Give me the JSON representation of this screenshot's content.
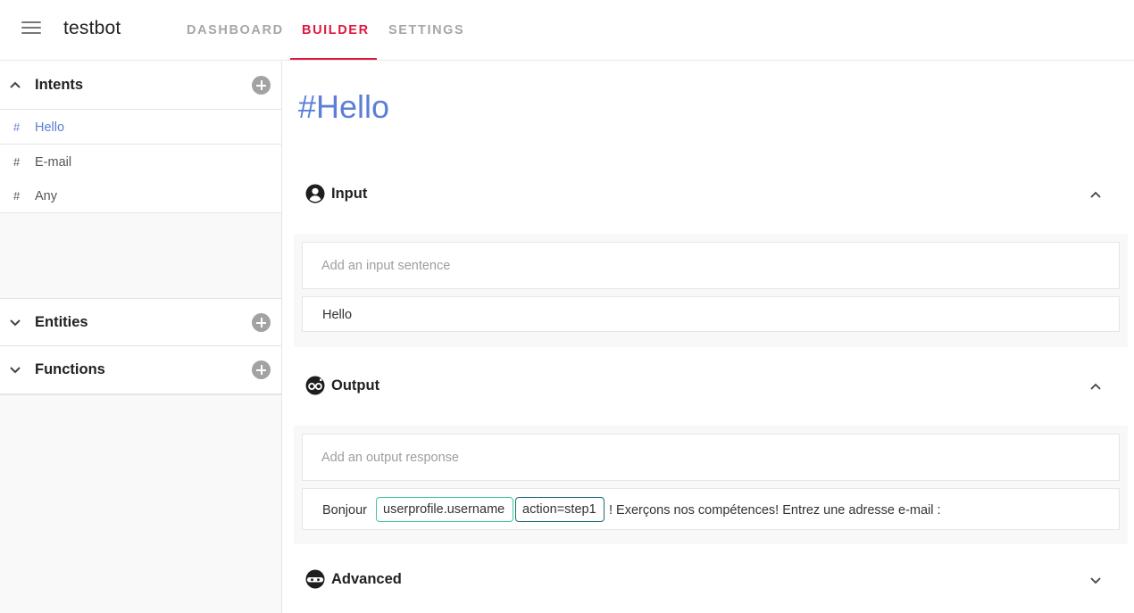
{
  "app": {
    "title": "testbot"
  },
  "tabs": [
    {
      "label": "DASHBOARD",
      "active": false
    },
    {
      "label": "BUILDER",
      "active": true
    },
    {
      "label": "SETTINGS",
      "active": false
    }
  ],
  "sidebar": {
    "intents": {
      "label": "Intents",
      "expanded": true,
      "items": [
        {
          "hash": "#",
          "name": "Hello",
          "active": true
        },
        {
          "hash": "#",
          "name": "E-mail",
          "active": false
        },
        {
          "hash": "#",
          "name": "Any",
          "active": false
        }
      ]
    },
    "entities": {
      "label": "Entities",
      "expanded": false
    },
    "functions": {
      "label": "Functions",
      "expanded": false
    }
  },
  "main": {
    "title": "#Hello",
    "input": {
      "title": "Input",
      "placeholder": "Add an input sentence",
      "sentences": [
        "Hello"
      ]
    },
    "output": {
      "title": "Output",
      "placeholder": "Add an output response",
      "response": {
        "prefix": "Bonjour",
        "chips": [
          "userprofile.username",
          "action=step1"
        ],
        "suffix": "! Exerçons nos compétences! Entrez une adresse e-mail :"
      }
    },
    "advanced": {
      "title": "Advanced"
    }
  },
  "colors": {
    "accent": "#e0173f",
    "intent_link": "#5b7fd6",
    "chip_green": "#3fc79a",
    "chip_teal": "#1c6e76"
  },
  "icons": {
    "menu": "hamburger-menu-icon",
    "input": "account-circle-icon",
    "output": "bot-face-icon",
    "advanced": "ninja-icon",
    "add": "plus-circle-icon"
  }
}
